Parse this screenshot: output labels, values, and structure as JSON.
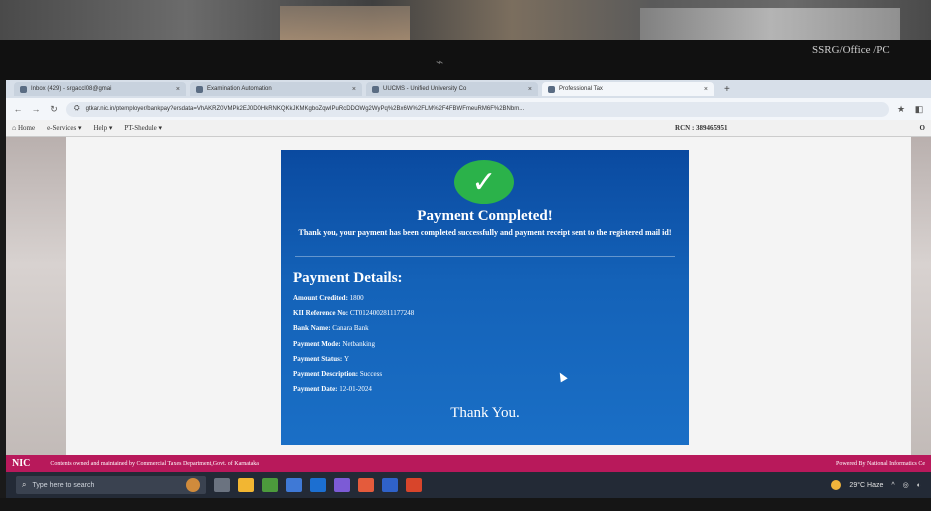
{
  "overlay_text": "SSRG/Office /PC",
  "browser": {
    "tabs": [
      {
        "label": "Inbox (429) - srgaccl08@gmai"
      },
      {
        "label": "Examination Automation"
      },
      {
        "label": "UUCMS - Unified University Co"
      },
      {
        "label": "Professional Tax"
      }
    ],
    "url": "gtkar.nic.in/ptemployer/bankpay?ersdata=VhAKRZ0VMPk2EJ0D0HkRNKQKkJKMKgboZqwIPuRcDDOWg2WyPq%2Bx6W%2FLM%2F4FBWFmeuRM6F%2BNbm..."
  },
  "site_nav": {
    "items": [
      "Home",
      "e-Services",
      "Help",
      "PT-Shedule"
    ],
    "rcn": "RCN : 389465951",
    "corner": "O"
  },
  "payment": {
    "title": "Payment Completed!",
    "message": "Thank you, your payment has been completed successfully and payment receipt sent to the registered mail id!",
    "details_title": "Payment Details:",
    "details": [
      {
        "label": "Amount Credited:",
        "value": "1800"
      },
      {
        "label": "KII Reference No:",
        "value": "CT0124002811177248"
      },
      {
        "label": "Bank Name:",
        "value": "Canara Bank"
      },
      {
        "label": "Payment Mode:",
        "value": "Netbanking"
      },
      {
        "label": "Payment Status:",
        "value": "Y"
      },
      {
        "label": "Payment Description:",
        "value": "Success"
      },
      {
        "label": "Payment Date:",
        "value": "12-01-2024"
      }
    ],
    "thanks": "Thank You."
  },
  "footer": {
    "logo": "NIC",
    "left": "Contents owned and maintained by Commercial Taxes Department,Govt. of Karnataka",
    "right": "Powered By National Informatics Ce"
  },
  "taskbar": {
    "search_placeholder": "Type here to search",
    "weather": "29°C Haze"
  }
}
